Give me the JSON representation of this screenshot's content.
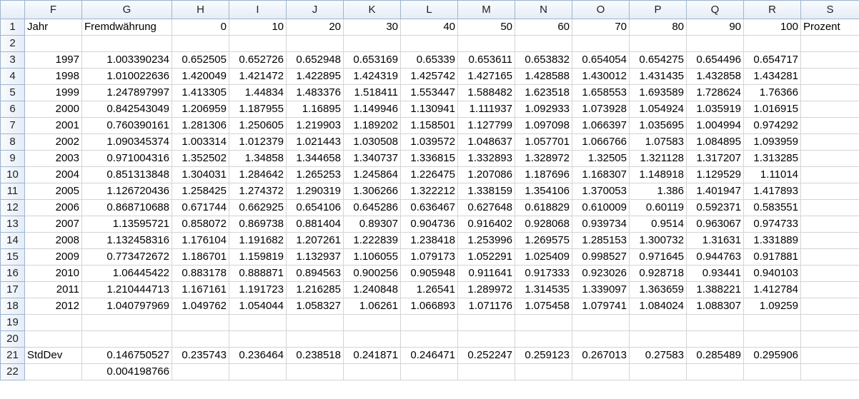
{
  "columns": [
    "F",
    "G",
    "H",
    "I",
    "J",
    "K",
    "L",
    "M",
    "N",
    "O",
    "P",
    "Q",
    "R",
    "S"
  ],
  "rows": [
    {
      "n": "1",
      "cells": [
        "Jahr",
        "Fremdwährung",
        "0",
        "10",
        "20",
        "30",
        "40",
        "50",
        "60",
        "70",
        "80",
        "90",
        "100",
        "Prozent"
      ]
    },
    {
      "n": "2",
      "cells": [
        "",
        "",
        "",
        "",
        "",
        "",
        "",
        "",
        "",
        "",
        "",
        "",
        "",
        ""
      ]
    },
    {
      "n": "3",
      "cells": [
        "1997",
        "1.003390234",
        "0.652505",
        "0.652726",
        "0.652948",
        "0.653169",
        "0.65339",
        "0.653611",
        "0.653832",
        "0.654054",
        "0.654275",
        "0.654496",
        "0.654717",
        ""
      ]
    },
    {
      "n": "4",
      "cells": [
        "1998",
        "1.010022636",
        "1.420049",
        "1.421472",
        "1.422895",
        "1.424319",
        "1.425742",
        "1.427165",
        "1.428588",
        "1.430012",
        "1.431435",
        "1.432858",
        "1.434281",
        ""
      ]
    },
    {
      "n": "5",
      "cells": [
        "1999",
        "1.247897997",
        "1.413305",
        "1.44834",
        "1.483376",
        "1.518411",
        "1.553447",
        "1.588482",
        "1.623518",
        "1.658553",
        "1.693589",
        "1.728624",
        "1.76366",
        ""
      ]
    },
    {
      "n": "6",
      "cells": [
        "2000",
        "0.842543049",
        "1.206959",
        "1.187955",
        "1.16895",
        "1.149946",
        "1.130941",
        "1.111937",
        "1.092933",
        "1.073928",
        "1.054924",
        "1.035919",
        "1.016915",
        ""
      ]
    },
    {
      "n": "7",
      "cells": [
        "2001",
        "0.760390161",
        "1.281306",
        "1.250605",
        "1.219903",
        "1.189202",
        "1.158501",
        "1.127799",
        "1.097098",
        "1.066397",
        "1.035695",
        "1.004994",
        "0.974292",
        ""
      ]
    },
    {
      "n": "8",
      "cells": [
        "2002",
        "1.090345374",
        "1.003314",
        "1.012379",
        "1.021443",
        "1.030508",
        "1.039572",
        "1.048637",
        "1.057701",
        "1.066766",
        "1.07583",
        "1.084895",
        "1.093959",
        ""
      ]
    },
    {
      "n": "9",
      "cells": [
        "2003",
        "0.971004316",
        "1.352502",
        "1.34858",
        "1.344658",
        "1.340737",
        "1.336815",
        "1.332893",
        "1.328972",
        "1.32505",
        "1.321128",
        "1.317207",
        "1.313285",
        ""
      ]
    },
    {
      "n": "10",
      "cells": [
        "2004",
        "0.851313848",
        "1.304031",
        "1.284642",
        "1.265253",
        "1.245864",
        "1.226475",
        "1.207086",
        "1.187696",
        "1.168307",
        "1.148918",
        "1.129529",
        "1.11014",
        ""
      ]
    },
    {
      "n": "11",
      "cells": [
        "2005",
        "1.126720436",
        "1.258425",
        "1.274372",
        "1.290319",
        "1.306266",
        "1.322212",
        "1.338159",
        "1.354106",
        "1.370053",
        "1.386",
        "1.401947",
        "1.417893",
        ""
      ]
    },
    {
      "n": "12",
      "cells": [
        "2006",
        "0.868710688",
        "0.671744",
        "0.662925",
        "0.654106",
        "0.645286",
        "0.636467",
        "0.627648",
        "0.618829",
        "0.610009",
        "0.60119",
        "0.592371",
        "0.583551",
        ""
      ]
    },
    {
      "n": "13",
      "cells": [
        "2007",
        "1.13595721",
        "0.858072",
        "0.869738",
        "0.881404",
        "0.89307",
        "0.904736",
        "0.916402",
        "0.928068",
        "0.939734",
        "0.9514",
        "0.963067",
        "0.974733",
        ""
      ]
    },
    {
      "n": "14",
      "cells": [
        "2008",
        "1.132458316",
        "1.176104",
        "1.191682",
        "1.207261",
        "1.222839",
        "1.238418",
        "1.253996",
        "1.269575",
        "1.285153",
        "1.300732",
        "1.31631",
        "1.331889",
        ""
      ]
    },
    {
      "n": "15",
      "cells": [
        "2009",
        "0.773472672",
        "1.186701",
        "1.159819",
        "1.132937",
        "1.106055",
        "1.079173",
        "1.052291",
        "1.025409",
        "0.998527",
        "0.971645",
        "0.944763",
        "0.917881",
        ""
      ]
    },
    {
      "n": "16",
      "cells": [
        "2010",
        "1.06445422",
        "0.883178",
        "0.888871",
        "0.894563",
        "0.900256",
        "0.905948",
        "0.911641",
        "0.917333",
        "0.923026",
        "0.928718",
        "0.93441",
        "0.940103",
        ""
      ]
    },
    {
      "n": "17",
      "cells": [
        "2011",
        "1.210444713",
        "1.167161",
        "1.191723",
        "1.216285",
        "1.240848",
        "1.26541",
        "1.289972",
        "1.314535",
        "1.339097",
        "1.363659",
        "1.388221",
        "1.412784",
        ""
      ]
    },
    {
      "n": "18",
      "cells": [
        "2012",
        "1.040797969",
        "1.049762",
        "1.054044",
        "1.058327",
        "1.06261",
        "1.066893",
        "1.071176",
        "1.075458",
        "1.079741",
        "1.084024",
        "1.088307",
        "1.09259",
        ""
      ]
    },
    {
      "n": "19",
      "cells": [
        "",
        "",
        "",
        "",
        "",
        "",
        "",
        "",
        "",
        "",
        "",
        "",
        "",
        ""
      ]
    },
    {
      "n": "20",
      "cells": [
        "",
        "",
        "",
        "",
        "",
        "",
        "",
        "",
        "",
        "",
        "",
        "",
        "",
        ""
      ]
    },
    {
      "n": "21",
      "cells": [
        "StdDev",
        "0.146750527",
        "0.235743",
        "0.236464",
        "0.238518",
        "0.241871",
        "0.246471",
        "0.252247",
        "0.259123",
        "0.267013",
        "0.27583",
        "0.285489",
        "0.295906",
        ""
      ]
    },
    {
      "n": "22",
      "cells": [
        "",
        "0.004198766",
        "",
        "",
        "",
        "",
        "",
        "",
        "",
        "",
        "",
        "",
        "",
        ""
      ]
    }
  ]
}
